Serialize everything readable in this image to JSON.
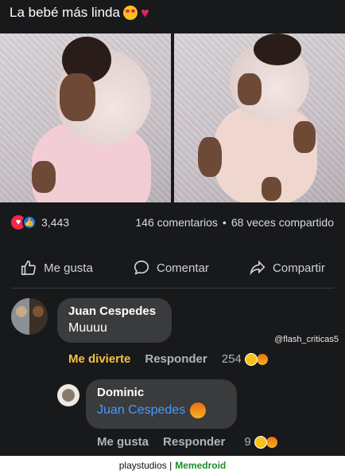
{
  "post": {
    "title": "La bebé más linda",
    "title_emojis": [
      "heart-eyes-emoji",
      "heart-emoji"
    ]
  },
  "stats": {
    "reaction_count": "3,443",
    "comments": "146 comentarios",
    "separator": "•",
    "shares": "68 veces compartido"
  },
  "actions": {
    "like": "Me gusta",
    "comment": "Comentar",
    "share": "Compartir"
  },
  "comments": [
    {
      "author": "Juan Cespedes",
      "text": "Muuuu",
      "actions": [
        "Me divierte",
        "Responder"
      ],
      "reaction_count": "254"
    },
    {
      "author": "Dominic",
      "mention": "Juan Cespedes",
      "actions": [
        "Me gusta",
        "Responder"
      ],
      "reaction_count": "9"
    }
  ],
  "watermark": "@flash_criticas5",
  "footer": {
    "left": "playstudios |",
    "right": "Memedroid"
  },
  "colors": {
    "background": "#18191b",
    "bubble": "#3a3b3c",
    "mention": "#4599ff",
    "haha_label": "#f5c33b",
    "footer_brand": "#1a8c2a"
  }
}
